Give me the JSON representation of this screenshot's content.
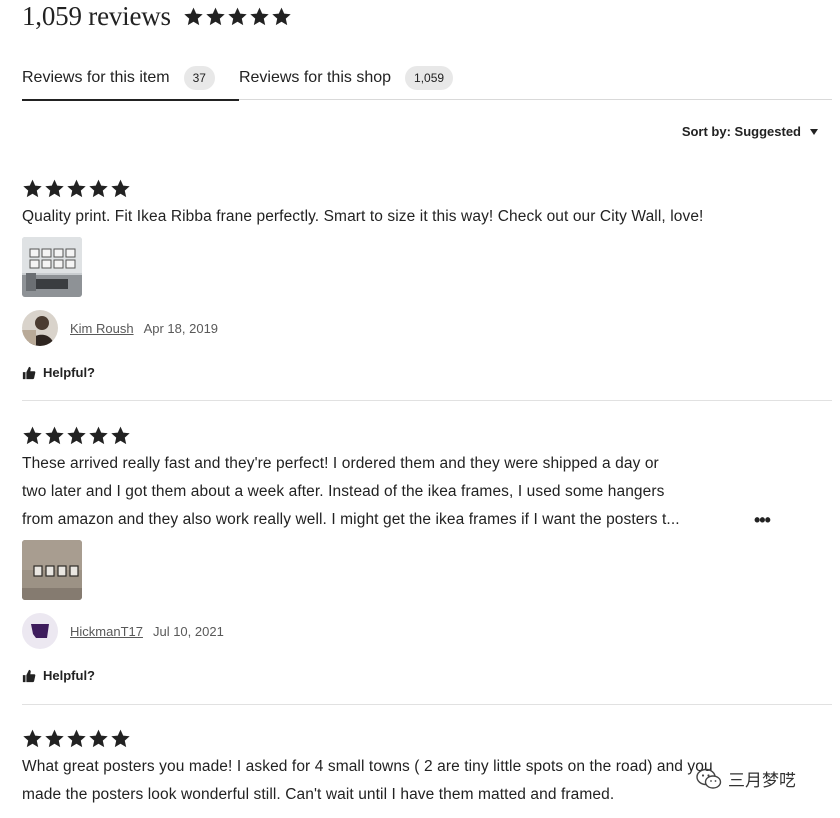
{
  "header": {
    "review_count": "1,059 reviews",
    "rating": 5
  },
  "tabs": [
    {
      "label": "Reviews for this item",
      "count": "37",
      "active": true
    },
    {
      "label": "Reviews for this shop",
      "count": "1,059",
      "active": false
    }
  ],
  "sort": {
    "label": "Sort by: Suggested"
  },
  "reviews": [
    {
      "rating": 5,
      "text_lines": [
        "Quality print. Fit Ikea Ribba frane perfectly. Smart to size it this way! Check out our City Wall, love!"
      ],
      "reviewer": "Kim Roush",
      "date": "Apr 18, 2019",
      "helpful": "Helpful?"
    },
    {
      "rating": 5,
      "text_lines": [
        "These arrived really fast and they're perfect! I ordered them and they were shipped a day or",
        "two later and I got them about a week after. Instead of the ikea frames, I used some hangers",
        "from amazon and they also work really well. I might get the ikea frames if I want the posters t..."
      ],
      "more": "•••",
      "reviewer": "HickmanT17",
      "date": "Jul 10, 2021",
      "helpful": "Helpful?"
    },
    {
      "rating": 5,
      "text_lines": [
        "What great posters you made! I asked for 4 small towns ( 2 are tiny little spots on the road) and you",
        "made the posters look wonderful still. Can't wait until I have them matted and framed."
      ]
    }
  ],
  "watermark": {
    "text": "三月梦呓"
  },
  "colors": {
    "text": "#222222",
    "muted": "#595959",
    "badge": "#e8e8e8",
    "divider": "#e1e1e1"
  },
  "icons": [
    "star-icon",
    "thumbs-up-icon",
    "caret-down-icon",
    "more-icon",
    "wechat-icon"
  ]
}
